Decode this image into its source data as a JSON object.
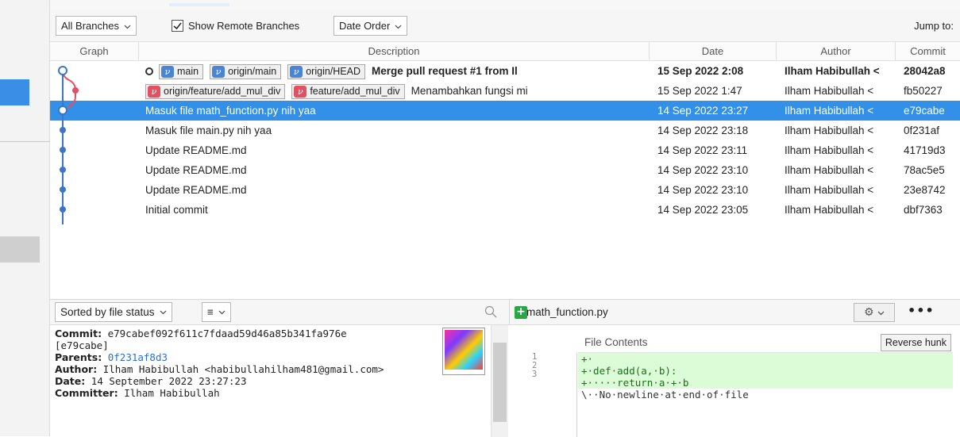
{
  "toolbar": {
    "branches_label": "All Branches",
    "show_remote_label": "Show Remote Branches",
    "show_remote_checked": true,
    "order_label": "Date Order",
    "jump_label": "Jump to:"
  },
  "columns": {
    "graph": "Graph",
    "description": "Description",
    "date": "Date",
    "author": "Author",
    "commit": "Commit"
  },
  "commits": [
    {
      "refs": [
        {
          "name": "main",
          "color": "blue"
        },
        {
          "name": "origin/main",
          "color": "blue"
        },
        {
          "name": "origin/HEAD",
          "color": "blue"
        }
      ],
      "message": "Merge pull request #1 from Il",
      "date": "15 Sep 2022 2:08",
      "author": "Ilham Habibullah <",
      "hash": "28042a8",
      "bold": true,
      "head": true
    },
    {
      "refs": [
        {
          "name": "origin/feature/add_mul_div",
          "color": "red"
        },
        {
          "name": "feature/add_mul_div",
          "color": "red"
        }
      ],
      "message": "Menambahkan fungsi mi",
      "date": "15 Sep 2022 1:47",
      "author": "Ilham Habibullah <",
      "hash": "fb50227"
    },
    {
      "refs": [],
      "message": "Masuk file math_function.py nih yaa",
      "date": "14 Sep 2022 23:27",
      "author": "Ilham Habibullah <",
      "hash": "e79cabe",
      "selected": true
    },
    {
      "refs": [],
      "message": "Masuk file main.py nih yaa",
      "date": "14 Sep 2022 23:18",
      "author": "Ilham Habibullah <",
      "hash": "0f231af"
    },
    {
      "refs": [],
      "message": "Update README.md",
      "date": "14 Sep 2022 23:11",
      "author": "Ilham Habibullah <",
      "hash": "41719d3"
    },
    {
      "refs": [],
      "message": "Update README.md",
      "date": "14 Sep 2022 23:10",
      "author": "Ilham Habibullah <",
      "hash": "78ac5e5"
    },
    {
      "refs": [],
      "message": "Update README.md",
      "date": "14 Sep 2022 23:10",
      "author": "Ilham Habibullah <",
      "hash": "23e8742"
    },
    {
      "refs": [],
      "message": "Initial commit",
      "date": "14 Sep 2022 23:05",
      "author": "Ilham Habibullah <",
      "hash": "dbf7363"
    }
  ],
  "files_pane": {
    "sort_label": "Sorted by file status"
  },
  "details": {
    "commit_label": "Commit:",
    "commit_hash": "e79cabef092f611c7fdaad59d46a85b341fa976e",
    "commit_short": "[e79cabe]",
    "parents_label": "Parents:",
    "parents_value": "0f231af8d3",
    "author_label": "Author:",
    "author_value": "Ilham Habibullah <habibullahilham481@gmail.com>",
    "date_label": "Date:",
    "date_value": "14 September 2022 23:27:23",
    "committer_label": "Committer:",
    "committer_value": "Ilham Habibullah"
  },
  "diff": {
    "filename": "math_function.py",
    "header_label": "File Contents",
    "reverse_label": "Reverse hunk",
    "line_numbers": [
      "1",
      "2",
      "3"
    ],
    "lines": [
      {
        "text": "+·",
        "type": "add"
      },
      {
        "text": "+·def·add(a,·b):",
        "type": "add"
      },
      {
        "text": "+·····return·a·+·b",
        "type": "add"
      },
      {
        "text": "\\··No·newline·at·end·of·file",
        "type": "plain"
      }
    ]
  },
  "colors": {
    "selection": "#3390e8",
    "graph_blue": "#3b76c9",
    "graph_red": "#e05263",
    "added_bg": "#dcfbd7"
  }
}
